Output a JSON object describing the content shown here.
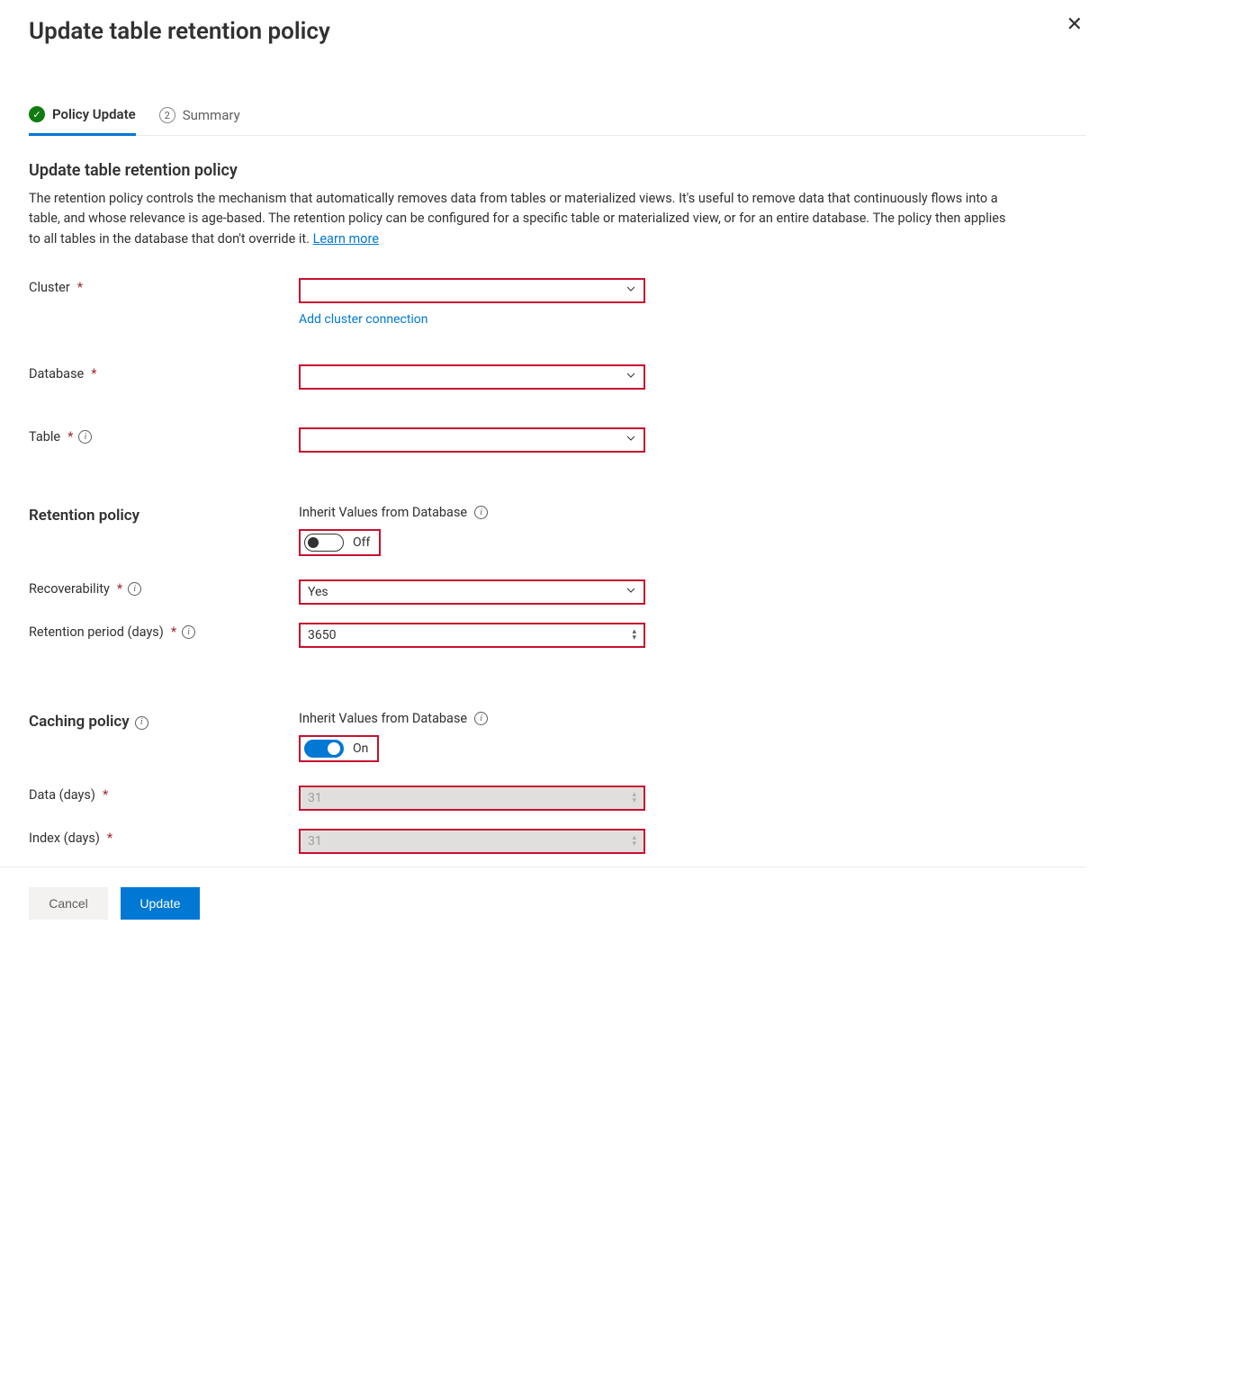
{
  "header": {
    "title": "Update table retention policy"
  },
  "steps": {
    "step1_label": "Policy Update",
    "step2_num": "2",
    "step2_label": "Summary"
  },
  "intro": {
    "heading": "Update table retention policy",
    "text": "The retention policy controls the mechanism that automatically removes data from tables or materialized views. It's useful to remove data that continuously flows into a table, and whose relevance is age-based. The retention policy can be configured for a specific table or materialized view, or for an entire database. The policy then applies to all tables in the database that don't override it. ",
    "learn_more": "Learn more"
  },
  "labels": {
    "cluster": "Cluster",
    "add_cluster": "Add cluster connection",
    "database": "Database",
    "table": "Table",
    "retention_heading": "Retention policy",
    "inherit_retention": "Inherit Values from Database",
    "recoverability": "Recoverability",
    "retention_period": "Retention period (days)",
    "caching_heading": "Caching policy",
    "inherit_caching": "Inherit Values from Database",
    "data_days": "Data (days)",
    "index_days": "Index (days)"
  },
  "values": {
    "cluster": "",
    "database": "",
    "table": "",
    "inherit_retention_on": false,
    "inherit_retention_state": "Off",
    "recoverability": "Yes",
    "retention_period": "3650",
    "inherit_caching_on": true,
    "inherit_caching_state": "On",
    "data_days": "31",
    "index_days": "31"
  },
  "buttons": {
    "cancel": "Cancel",
    "update": "Update"
  }
}
